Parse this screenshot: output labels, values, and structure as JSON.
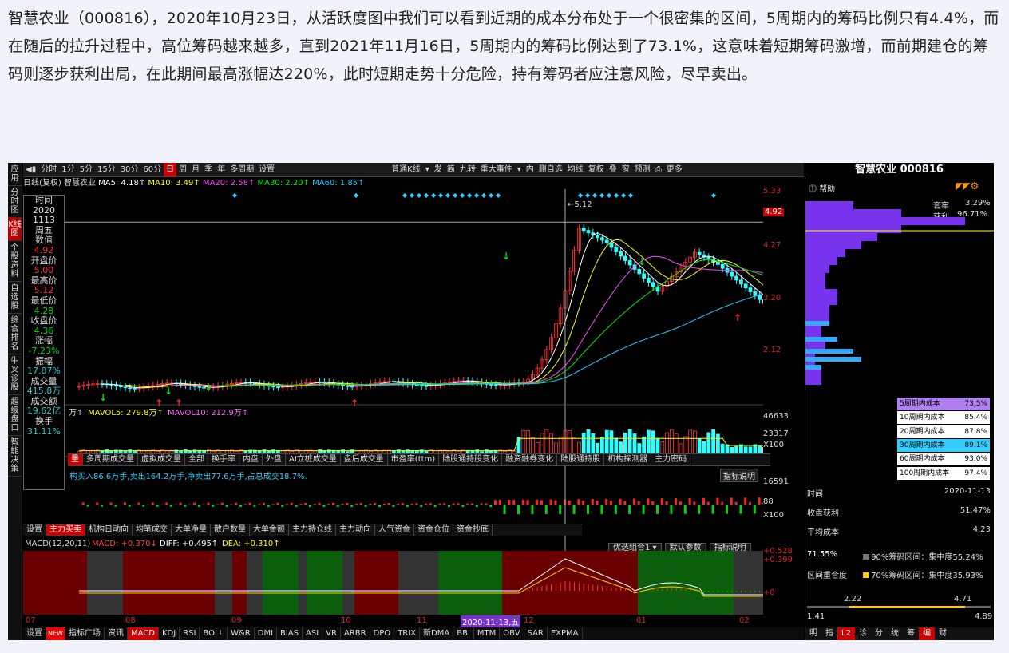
{
  "article": "智慧农业（000816），2020年10月23日，从活跃度图中我们可以看到近期的成本分布处于一个很密集的区间，5周期内的筹码比例只有4.4%，而在随后的拉升过程中，高位筹码越来越多，直到2021年11月16日，5周期内的筹码比例达到了73.1%，这意味着短期筹码激增，而前期建仓的筹码则逐步获利出局，在此期间最高涨幅达220%，此时短期走势十分危险，持有筹码者应注意风险，尽早卖出。",
  "left_sidebar": [
    "应用",
    "分时图",
    "K线图",
    "个股资料",
    "自选股",
    "综合排名",
    "牛叉诊股",
    "超级盘口",
    "智能决策"
  ],
  "toolbar": [
    "分时",
    "1分",
    "5分",
    "15分",
    "30分",
    "60分",
    "日",
    "周",
    "月",
    "季",
    "年",
    "多周期",
    "设置"
  ],
  "toolbar_active": "日",
  "toolbar_right": [
    "普通K线",
    "▾",
    "发",
    "简",
    "九转",
    "重大事件",
    "▾",
    "内",
    "删自选",
    "均线",
    "复权",
    "叠",
    "窗",
    "预测",
    "⎙",
    "更多"
  ],
  "ma_line": {
    "prefix": "日线(复权) 智慧农业",
    "items": [
      {
        "text": "MA5: 4.18↑",
        "color": "#ffffff"
      },
      {
        "text": "MA10: 3.49↑",
        "color": "#ffff00"
      },
      {
        "text": "MA20: 2.58↑",
        "color": "#ff44ff"
      },
      {
        "text": "MA30: 2.20↑",
        "color": "#00ee00"
      },
      {
        "text": "MA60: 1.85↑",
        "color": "#22ccff"
      }
    ]
  },
  "info": [
    {
      "l": "时间"
    },
    {
      "v": "2020",
      "c": "l"
    },
    {
      "v": "1113",
      "c": "l"
    },
    {
      "l": "周五"
    },
    {
      "l": "数值"
    },
    {
      "v": "4.92",
      "c": "r"
    },
    {
      "l": "开盘价"
    },
    {
      "v": "5.00",
      "c": "r"
    },
    {
      "l": "最高价"
    },
    {
      "v": "5.12",
      "c": "r"
    },
    {
      "l": "最低价"
    },
    {
      "v": "4.28",
      "c": "g"
    },
    {
      "l": "收盘价"
    },
    {
      "v": "4.36",
      "c": "g"
    },
    {
      "l": "涨幅"
    },
    {
      "v": "-7.23%",
      "c": "g"
    },
    {
      "l": "振幅"
    },
    {
      "v": "17.87%",
      "c": "c"
    },
    {
      "l": "成交量"
    },
    {
      "v": "415.8万",
      "c": "c"
    },
    {
      "l": "成交额"
    },
    {
      "v": "19.62亿",
      "c": "c"
    },
    {
      "l": "换手"
    },
    {
      "v": "31.11%",
      "c": "c"
    }
  ],
  "price_axis": [
    "5.33",
    "4.92",
    "4.27",
    "3.20",
    "2.12"
  ],
  "crosshair_label": "5.12",
  "vol_line": {
    "a": "万↑",
    "b": "MAVOL5: 279.8万↑",
    "c": "MAVOL10: 212.9万↑"
  },
  "vol_axis": [
    "46633",
    "23317",
    "X100"
  ],
  "flow_tabs": [
    "量",
    "多周期成交量",
    "虚拟成交量",
    "全部",
    "换手率",
    "内盘",
    "外盘",
    "AI立桩成交量",
    "盘后成交量",
    "市盈率(ttm)",
    "陆股通持股变化",
    "融资融券变化",
    "陆股通持股",
    "机构探测器",
    "主力密码"
  ],
  "flow_text": "构买入86.6万手,卖出164.2万手,净卖出77.6万手,占总成交18.7%.",
  "flow_btn": "指标说明",
  "flow_axis": [
    "16591",
    "88",
    "X100"
  ],
  "sub_tabs": [
    "设置",
    "主力买卖",
    "机构日动向",
    "均笔成交",
    "大单净量",
    "散户数量",
    "大单金额",
    "主力持仓线",
    "主力动向",
    "人气资金",
    "资金仓位",
    "资金抄底"
  ],
  "macd_line": {
    "name": "MACD(12,20,11)",
    "macd": "MACD: +0.370↓",
    "diff": "DIFF: +0.495↑",
    "dea": "DEA: +0.310↑"
  },
  "macd_btns": [
    "优选组合1 ▾",
    "默认参数",
    "指标说明"
  ],
  "macd_axis": [
    "+0.528",
    "+0.399",
    "+0"
  ],
  "x_dates": [
    "07",
    "08",
    "09",
    "10",
    "11",
    "12",
    "01",
    "02"
  ],
  "cursor_date": "2020-11-13,五",
  "bottom_tabs": [
    "设置",
    "NEW",
    "指标广场",
    "资讯",
    "MACD",
    "KDJ",
    "RSI",
    "BOLL",
    "W&R",
    "DMI",
    "BIAS",
    "ASI",
    "VR",
    "ARBR",
    "DPO",
    "TRIX",
    "新DMA",
    "BBI",
    "MTM",
    "OBV",
    "SAR",
    "EXPMA"
  ],
  "right": {
    "title": "智慧农业 000816",
    "help": "帮助",
    "trap_label": "套牢",
    "trap_val": "3.29%",
    "profit_label": "获利",
    "profit_val": "96.71%",
    "cost_rows": [
      {
        "l": "5周期内成本",
        "v": "73.5%",
        "bg": "#b080f0"
      },
      {
        "l": "10周期内成本",
        "v": "85.4%",
        "bg": "#ffffff"
      },
      {
        "l": "20周期内成本",
        "v": "87.8%",
        "bg": "#ffffff"
      },
      {
        "l": "30周期内成本",
        "v": "89.1%",
        "bg": "#33ccff"
      },
      {
        "l": "60周期内成本",
        "v": "93.0%",
        "bg": "#ffffff"
      },
      {
        "l": "100周期内成本",
        "v": "97.4%",
        "bg": "#ffffff"
      }
    ],
    "stats": [
      {
        "l": "时间",
        "v": "2020-11-13"
      },
      {
        "l": "收盘获利",
        "v": "51.47%"
      },
      {
        "l": "平均成本",
        "v": "4.23"
      }
    ],
    "conc_pct": "71.55%",
    "conc1": "90%筹码区间：集中度55.24%",
    "conc2": "70%筹码区间：集中度35.93%",
    "conc_label": "区间重合度",
    "range_a": "2.22",
    "range_b": "4.71",
    "range_c": "1.41",
    "range_d": "4.89",
    "bottom_icons": [
      "明",
      "指",
      "L2",
      "诊",
      "分",
      "统",
      "筹",
      "编",
      "财"
    ]
  }
}
